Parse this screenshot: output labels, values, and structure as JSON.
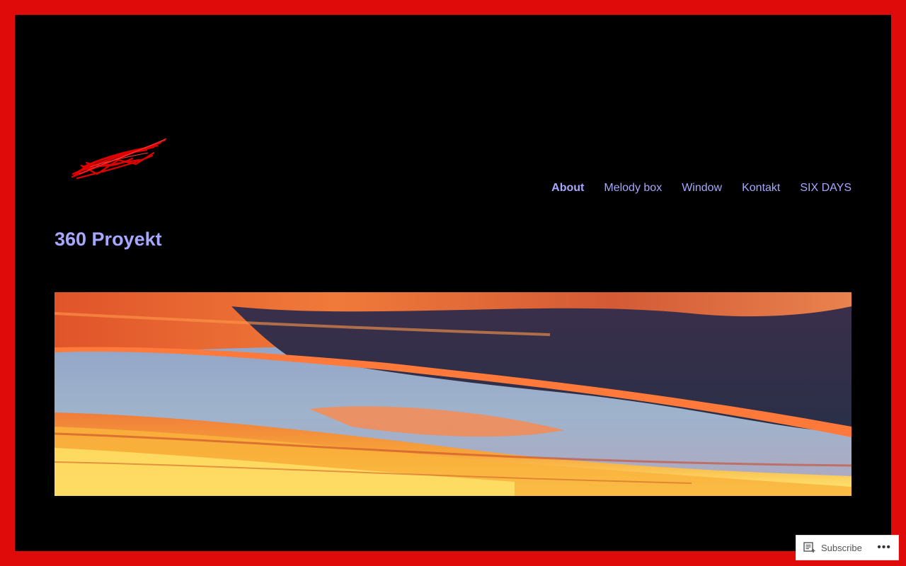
{
  "nav": {
    "items": [
      {
        "label": "About",
        "active": true
      },
      {
        "label": "Melody box"
      },
      {
        "label": "Window"
      },
      {
        "label": "Kontakt"
      },
      {
        "label": "SIX DAYS"
      }
    ]
  },
  "page": {
    "title": "360 Proyekt"
  },
  "subscribe": {
    "label": "Subscribe",
    "more": "•••"
  },
  "colors": {
    "frame": "#df0a0a",
    "background": "#000000",
    "link": "#a7a7ff"
  }
}
